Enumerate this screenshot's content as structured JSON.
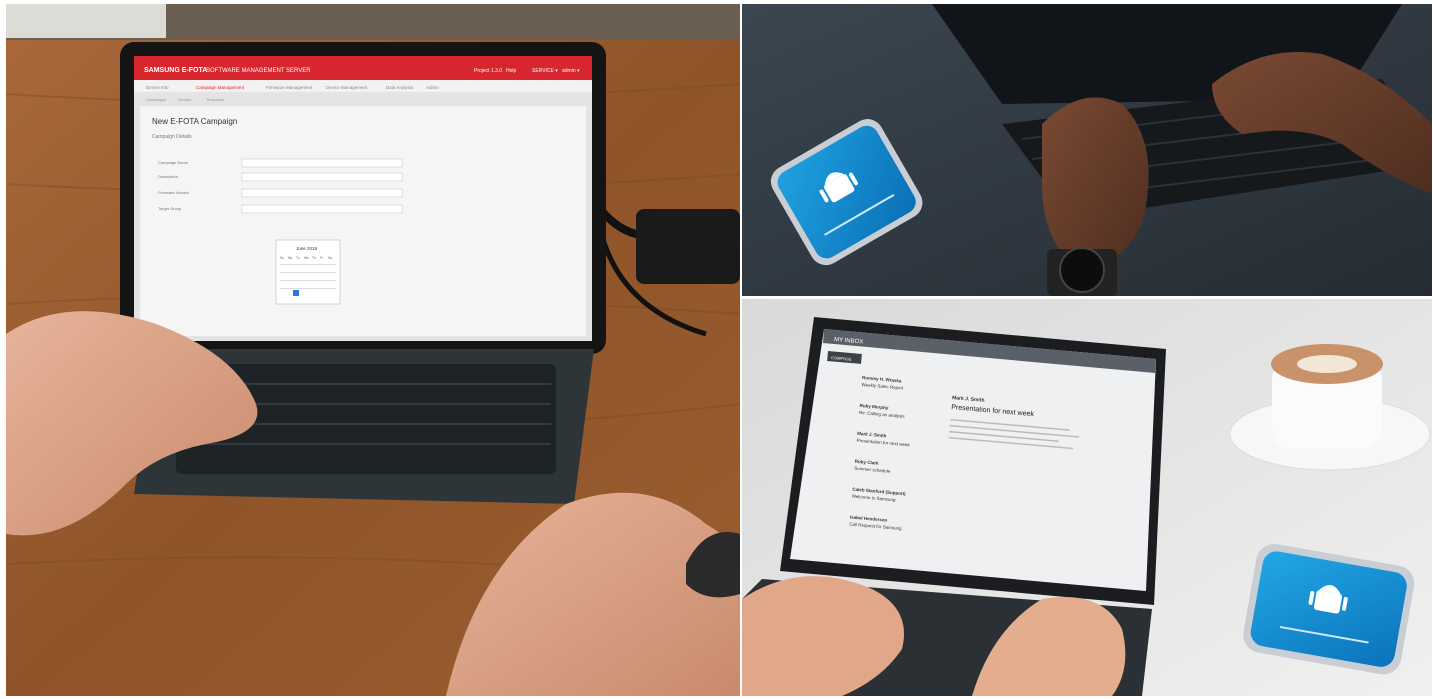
{
  "left_photo": {
    "brand": "SAMSUNG E-FOTA",
    "product": "SOFTWARE MANAGEMENT SERVER",
    "header_right": [
      "Project 1.3.0",
      "Help",
      "SERVICE ▾",
      "admin ▾"
    ],
    "nav_tabs": [
      "Device Info",
      "Campaign Management",
      "Firmware Management",
      "Device Management",
      "Data Analysis",
      "Admin"
    ],
    "sub_tabs": [
      "Campaigns",
      "Groups",
      "Templates"
    ],
    "page_title": "New E-FOTA Campaign",
    "section_title": "Campaign Details",
    "form_labels": [
      "Campaign Name",
      "Description",
      "Firmware Version",
      "Target Group"
    ],
    "calendar": {
      "month": "June 2019",
      "weekdays": [
        "Su",
        "Mo",
        "Tu",
        "We",
        "Th",
        "Fr",
        "Sa"
      ]
    }
  },
  "top_right_photo": {
    "phone_screen": "android-update-icon"
  },
  "bottom_right_photo": {
    "app_title": "MY INBOX",
    "compose_label": "COMPOSE",
    "emails": [
      {
        "sender": "Rommy H. Wraska",
        "subject": "Weekly Sales Report"
      },
      {
        "sender": "Ruby Murphy",
        "subject": "Re: Calling an analysis"
      },
      {
        "sender": "Mark J. Smith",
        "subject": "Presentation for next week"
      },
      {
        "sender": "Ruby Clark",
        "subject": "Summer schedule"
      },
      {
        "sender": "Caleb Stanford (Support)",
        "subject": "Welcome to Samsung"
      },
      {
        "sender": "Isabel Henderson",
        "subject": "Call Request for Samsung"
      }
    ],
    "open_email": {
      "sender": "Mark J. Smith",
      "subject": "Presentation for next week"
    },
    "phone_screen": "android-update-icon"
  }
}
